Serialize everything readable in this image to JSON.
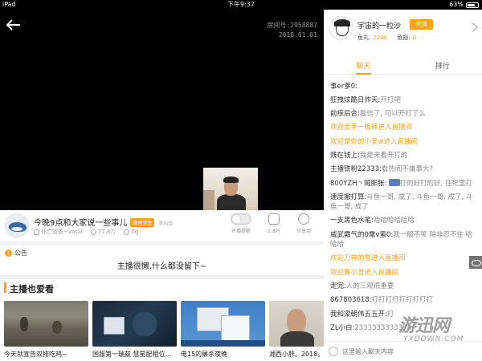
{
  "status_bar": {
    "device": "iPad",
    "time": "下午9:37",
    "battery": "63%"
  },
  "video": {
    "room_number": "房间号:2958887",
    "date": "2018.01.01"
  },
  "anchor": {
    "title": "今晚9点和大家说一些事儿",
    "category": "绝地求生",
    "rank": "黑科单",
    "name": "死亡宣告~vasili",
    "followers": "77.8万",
    "weight": "0g",
    "controls": {
      "toggle": "开播提醒",
      "heart": "2.8万",
      "share": "分享到"
    }
  },
  "notice": {
    "label": "公告",
    "text": "主播很懒,什么都没留下~"
  },
  "favorites": {
    "title": "主播也爱看",
    "items": [
      {
        "caption": "今天就宣告双排吃鸡~"
      },
      {
        "caption": "国服第一瑞兹 慧星配相位…"
      },
      {
        "caption": "电15的屠杀夜晚"
      },
      {
        "caption": "湘西小胖。2018。祝"
      }
    ]
  },
  "profile": {
    "name": "宇宙的一粒沙",
    "recharge": "充值",
    "yuwan_label": "鱼丸:",
    "yuwan": "2240",
    "yuchi_label": "鱼翅:",
    "yuchi": "0"
  },
  "tabs": {
    "chat": "聊天",
    "rank": "排行"
  },
  "chat": [
    {
      "user": "事er爹0:",
      "text": "",
      "type": "msg"
    },
    {
      "user": "狂拽炫酷日炸天:",
      "text": "开打吧",
      "type": "msg"
    },
    {
      "user": "前痒后合:",
      "text": "我信了, 可以开打了么",
      "type": "msg"
    },
    {
      "user": "",
      "text": "欢迎反手一板砖进入直播间",
      "type": "enter"
    },
    {
      "user": "",
      "text": "欢迎是你的小爱w进入直播间",
      "type": "enter"
    },
    {
      "user": "贱在钱上:",
      "text": "我是来看开打的",
      "type": "msg"
    },
    {
      "user": "主播铁粉22333:",
      "text": "看热闹不嫌事大?",
      "type": "msg"
    },
    {
      "user": "800YZH丶贼膨胀:",
      "text": "打的好打的好, 往死里打",
      "type": "msg",
      "badge": true
    },
    {
      "user": "速度撤打算:",
      "text": "斗鱼一哥, 成了, 斗鱼一哥, 成了, 斗鱼一哥, 成了",
      "type": "msg"
    },
    {
      "user": "一支黑色水笔:",
      "text": "哈哈哈哈哈哈",
      "type": "msg"
    },
    {
      "user": "威武霸气的0鼋v蜜0:",
      "text": "我一般不笑 除非忍不住 哈哈哈",
      "type": "msg"
    },
    {
      "user": "",
      "text": "欢迎刀神的雪进入直播间",
      "type": "enter"
    },
    {
      "user": "",
      "text": "欢迎寡小言进入直播间",
      "type": "enter"
    },
    {
      "user": "走完:",
      "text": "人的三观很重要",
      "type": "msg"
    },
    {
      "user": "867803618:",
      "text": "打打打打打打打打打",
      "type": "msg"
    },
    {
      "user": "我和梁朝伟五五开:",
      "text": "打",
      "type": "msg"
    },
    {
      "user": "ZL小白:",
      "text": "2333333333333",
      "type": "msg"
    }
  ],
  "chat_input": {
    "placeholder": "这里输入聊天内容"
  },
  "watermark": {
    "cn": "游迅网",
    "en": "YXDOWN.COM"
  }
}
